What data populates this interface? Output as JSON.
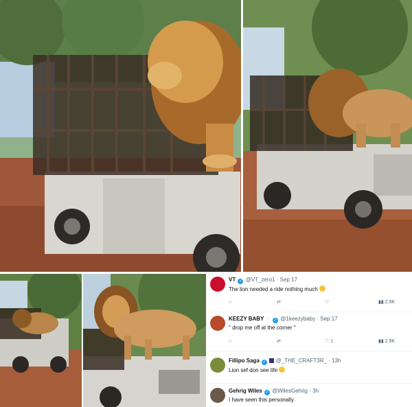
{
  "tweets": [
    {
      "display_name": "VT",
      "handle": "@VT_zero1",
      "date": "Sep 17",
      "text": "The lion needed a ride nothing much",
      "emoji": "crying-laughing",
      "reply_count": "",
      "retweet_count": "",
      "like_count": "",
      "view_count": "2.9K",
      "avatar_color": "#c8102e"
    },
    {
      "display_name": "KEEZY BABY",
      "handle": "@1keezybaby",
      "date": "Sep 17",
      "text": "\" drop me off at the corner \"",
      "reply_count": "",
      "retweet_count": "",
      "like_count": "1",
      "view_count": "2.9K",
      "avatar_color": "#b84a2a"
    },
    {
      "display_name": "Fillipo Saga",
      "handle": "@_THE_CRAFT3R_",
      "date": "13h",
      "text": "Lion sef don see life",
      "emoji": "crying-laughing",
      "avatar_color": "#7a8c3a"
    },
    {
      "display_name": "Gehrig Wiles",
      "handle": "@WilesGehrig",
      "date": "3h",
      "text": "I have seen this personally.",
      "avatar_color": "#6b5a4a"
    }
  ],
  "icons": {
    "reply": "reply-icon",
    "retweet": "retweet-icon",
    "like": "heart-icon",
    "views": "views-icon",
    "verified": "verified-badge-icon"
  },
  "colors": {
    "verified_blue": "#1d9bf0",
    "meta_gray": "#536471",
    "text_dark": "#0f1419"
  }
}
